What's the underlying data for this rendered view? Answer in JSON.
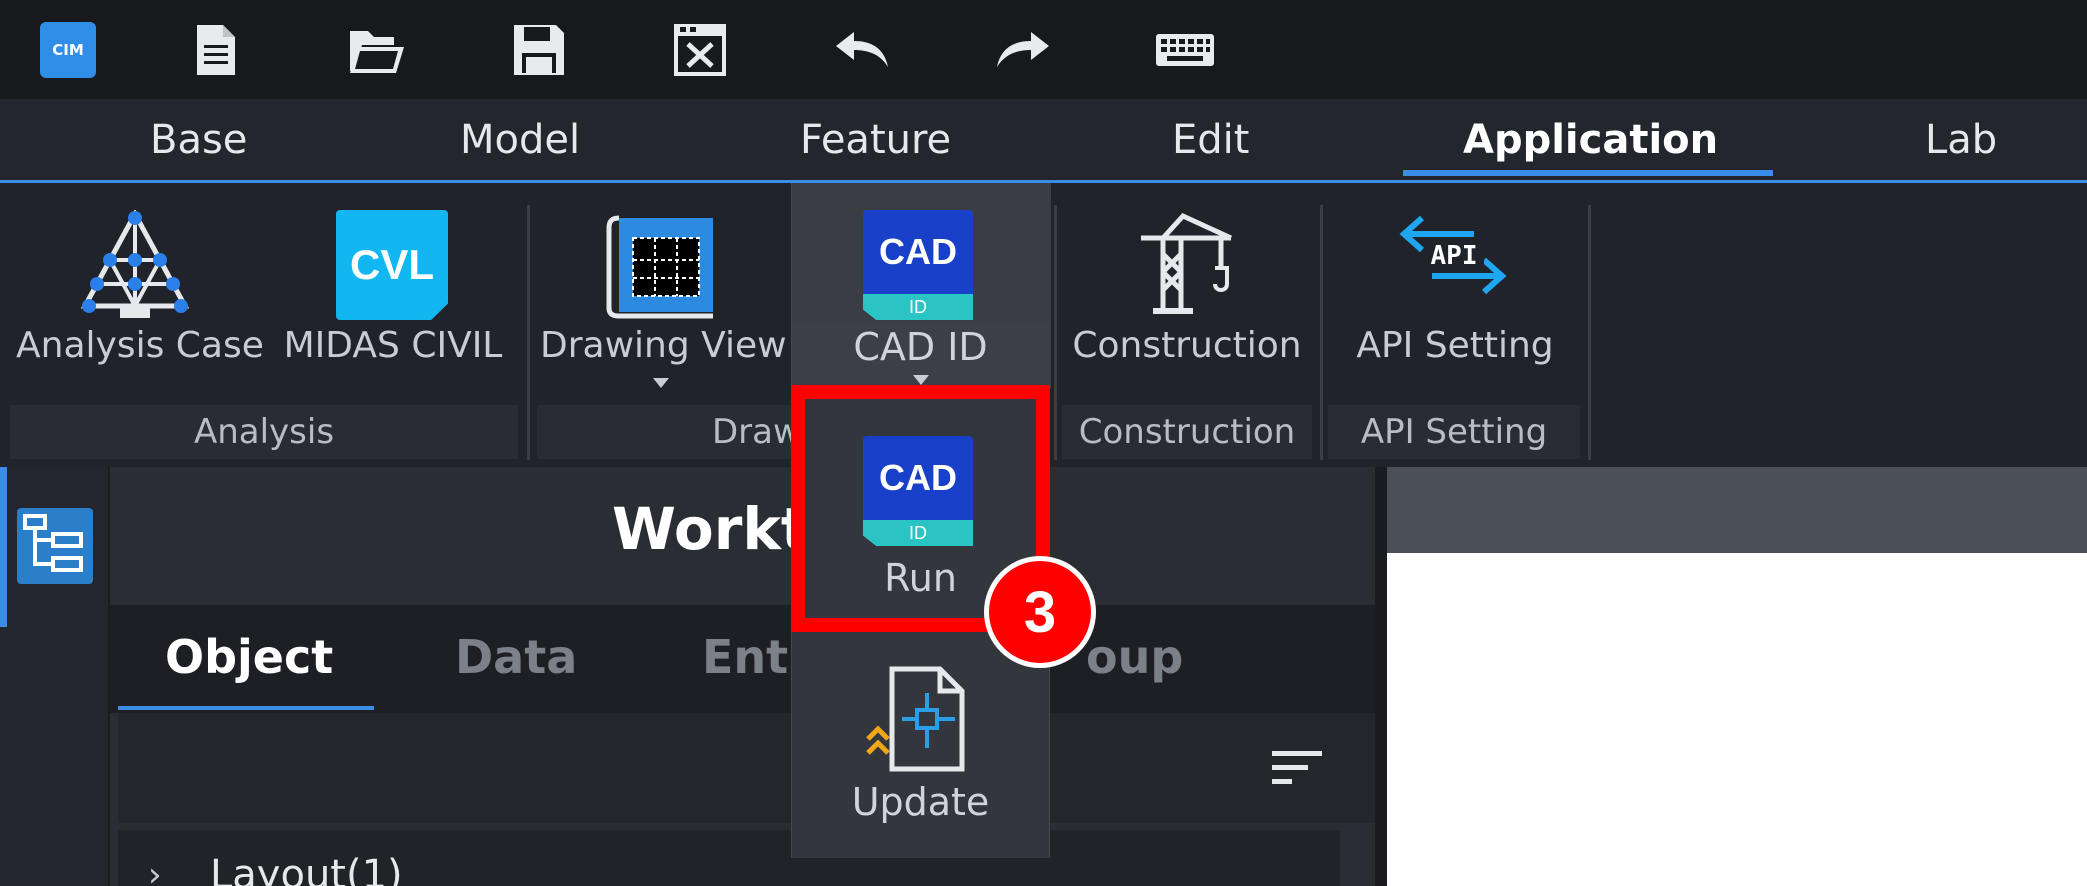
{
  "quick_access": {
    "logo_text": "CIM",
    "icons": [
      "new-file-icon",
      "open-folder-icon",
      "save-icon",
      "close-file-icon",
      "undo-icon",
      "redo-icon",
      "keyboard-icon"
    ]
  },
  "ribbon_tabs": [
    "Base",
    "Model",
    "Feature",
    "Edit",
    "Application",
    "Lab"
  ],
  "active_tab": "Application",
  "ribbon": {
    "analysis_case": "Analysis Case",
    "midas_civil": "MIDAS CIVIL",
    "midas_civil_icon_text": "CVL",
    "drawing_view": "Drawing View",
    "cad_id": "CAD ID",
    "construction": "Construction",
    "api_setting": "API Setting",
    "api_icon_text": "API",
    "groups": {
      "analysis": "Analysis",
      "drawing": "Draw",
      "construction": "Construction",
      "api_setting": "API Setting"
    }
  },
  "dropdown": {
    "cad_icon_top": "CAD",
    "cad_icon_bottom": "ID",
    "run": "Run",
    "update": "Update"
  },
  "annotation": {
    "step": "3"
  },
  "worktree": {
    "title": "Workt",
    "tabs": [
      "Object",
      "Data",
      "Enti",
      "oup"
    ],
    "active_tab": "Object",
    "list_items": [
      {
        "label": "Layout(1)"
      }
    ]
  },
  "colors": {
    "accent": "#3a8ee6",
    "highlight": "#ff0000",
    "cad_blue": "#1940c8",
    "cad_teal": "#2bc4c4",
    "cvl_blue": "#12b7f2"
  }
}
